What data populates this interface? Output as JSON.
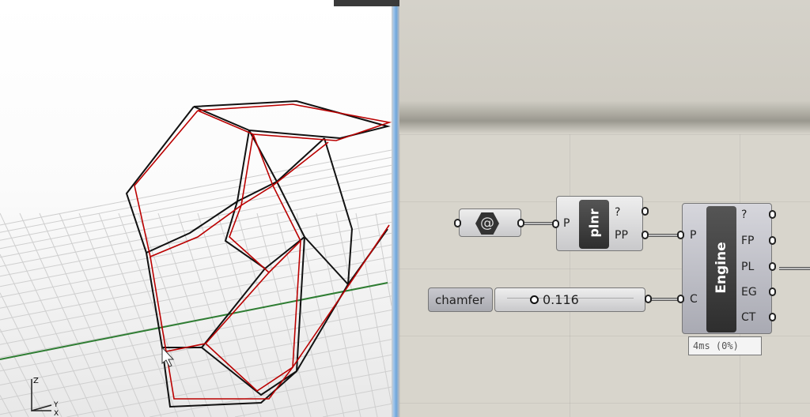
{
  "viewport": {
    "axis_labels": {
      "z": "Z",
      "y": "Y",
      "x": "X"
    }
  },
  "canvas": {
    "param_component": {
      "icon": "geometry-hex-icon"
    },
    "plnr": {
      "input": "P",
      "name": "plnr",
      "outputs": [
        "?",
        "PP"
      ]
    },
    "engine": {
      "inputs": [
        "P",
        "C"
      ],
      "name": "Engine",
      "outputs": [
        "?",
        "FP",
        "PL",
        "EG",
        "CT"
      ],
      "timing": "4ms (0%)"
    },
    "slider": {
      "label": "chamfer",
      "value": "0.116"
    }
  }
}
